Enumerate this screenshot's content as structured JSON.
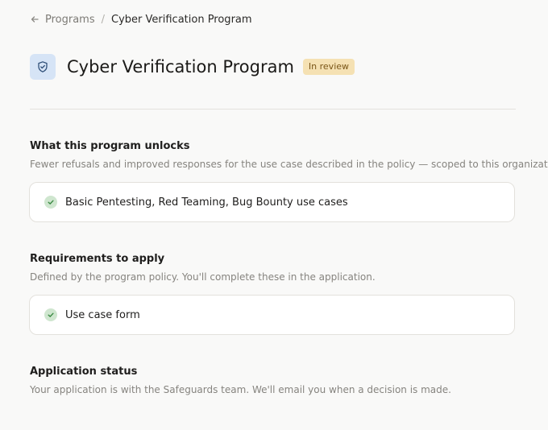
{
  "breadcrumb": {
    "back_icon": "arrow-left-icon",
    "parent": "Programs",
    "separator": "/",
    "current": "Cyber Verification Program"
  },
  "header": {
    "icon": "shield-check-icon",
    "title": "Cyber Verification Program",
    "status_badge": "In review"
  },
  "colors": {
    "badge_bg": "#f5e1b3",
    "badge_text": "#7a5618",
    "icon_tile_bg": "#d6e4f6",
    "check_bg": "#cfe6cf",
    "check_mark": "#3b8a43"
  },
  "sections": {
    "unlocks": {
      "title": "What this program unlocks",
      "description": "Fewer refusals and improved responses for the use case described in the policy — scoped to this organization.",
      "items": [
        {
          "icon": "check-circle-icon",
          "label": "Basic Pentesting, Red Teaming, Bug Bounty use cases"
        }
      ]
    },
    "requirements": {
      "title": "Requirements to apply",
      "description": "Defined by the program policy. You'll complete these in the application.",
      "items": [
        {
          "icon": "check-circle-icon",
          "label": "Use case form"
        }
      ]
    },
    "status": {
      "title": "Application status",
      "description": "Your application is with the Safeguards team. We'll email you when a decision is made."
    }
  }
}
